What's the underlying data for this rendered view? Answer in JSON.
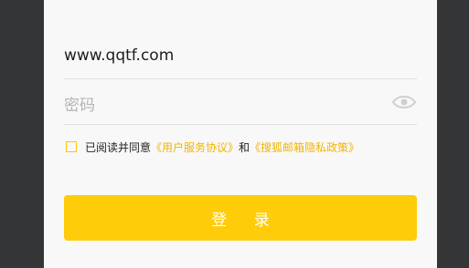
{
  "form": {
    "account_value": "www.qqtf.com",
    "password_placeholder": "密码",
    "agreement": {
      "prefix": "已阅读并同意",
      "user_agreement": "《用户服务协议》",
      "conjunction": "和",
      "privacy_policy": "《搜狐邮箱隐私政策》"
    },
    "login_label": "登 录"
  },
  "icons": {
    "password_toggle": "eye-icon",
    "agreement_checkbox": "checkbox-icon"
  },
  "colors": {
    "accent": "#ffcc0a",
    "link": "#f3b400",
    "background": "#333537"
  }
}
